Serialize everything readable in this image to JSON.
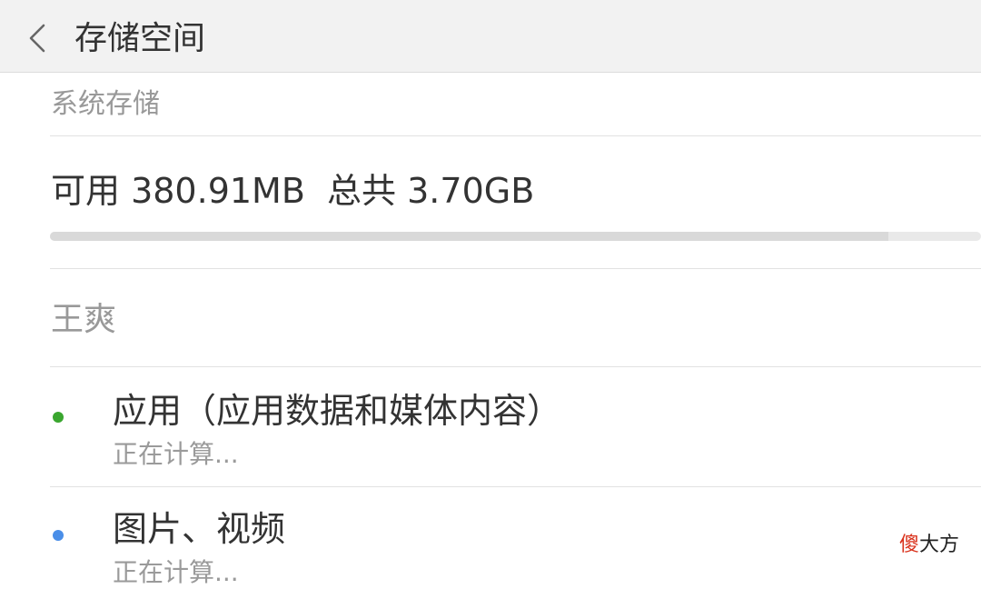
{
  "header": {
    "title": "存储空间",
    "back_icon": "chevron-left-icon"
  },
  "system_storage": {
    "section_label": "系统存储",
    "summary": "可用 380.91MB  总共 3.70GB",
    "used_fraction": 0.9
  },
  "user_section": {
    "label": "王爽"
  },
  "categories": [
    {
      "title": "应用（应用数据和媒体内容）",
      "status": "正在计算...",
      "dot_color": "#3aa62f"
    },
    {
      "title": "图片、视频",
      "status": "正在计算...",
      "dot_color": "#4a8ee8"
    }
  ],
  "watermark": {
    "char1": "傻",
    "char2": "大方",
    "char1_color": "#d9301a",
    "char2_color": "#222222"
  }
}
